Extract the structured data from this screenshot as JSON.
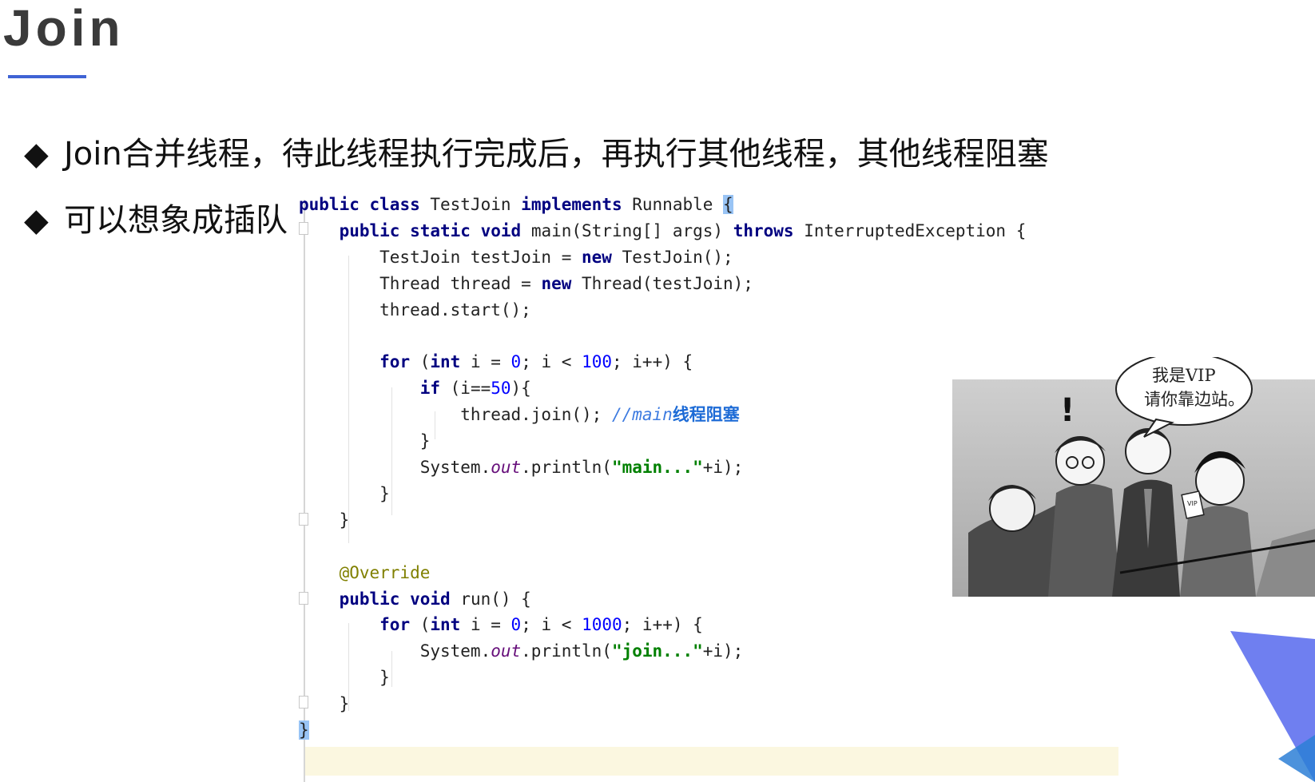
{
  "slide": {
    "title": "Join",
    "bullets": [
      "Join合并线程，待此线程执行完成后，再执行其他线程，其他线程阻塞",
      "可以想象成插队"
    ],
    "bullet_marker": "◆"
  },
  "code": {
    "language": "java",
    "lines": [
      "public class TestJoin implements Runnable {",
      "    public static void main(String[] args) throws InterruptedException {",
      "        TestJoin testJoin = new TestJoin();",
      "        Thread thread = new Thread(testJoin);",
      "        thread.start();",
      "",
      "        for (int i = 0; i < 100; i++) {",
      "            if (i==50){",
      "                thread.join(); //main线程阻塞",
      "            }",
      "            System.out.println(\"main...\"+i);",
      "        }",
      "    }",
      "",
      "    @Override",
      "    public void run() {",
      "        for (int i = 0; i < 1000; i++) {",
      "            System.out.println(\"join...\"+i);",
      "        }",
      "    }",
      "}"
    ]
  },
  "cartoon": {
    "speech_line1": "我是VIP",
    "speech_line2": "请你靠边站。",
    "exclamation": "!",
    "card_text": "VIP"
  },
  "colors": {
    "title_underline": "#3f63d4",
    "keyword": "#000080",
    "number": "#0000ff",
    "string": "#008000",
    "comment": "#3d7be0",
    "annotation": "#808000",
    "current_line": "#fbf7e0",
    "corner_deco": "#6f7ff0"
  }
}
